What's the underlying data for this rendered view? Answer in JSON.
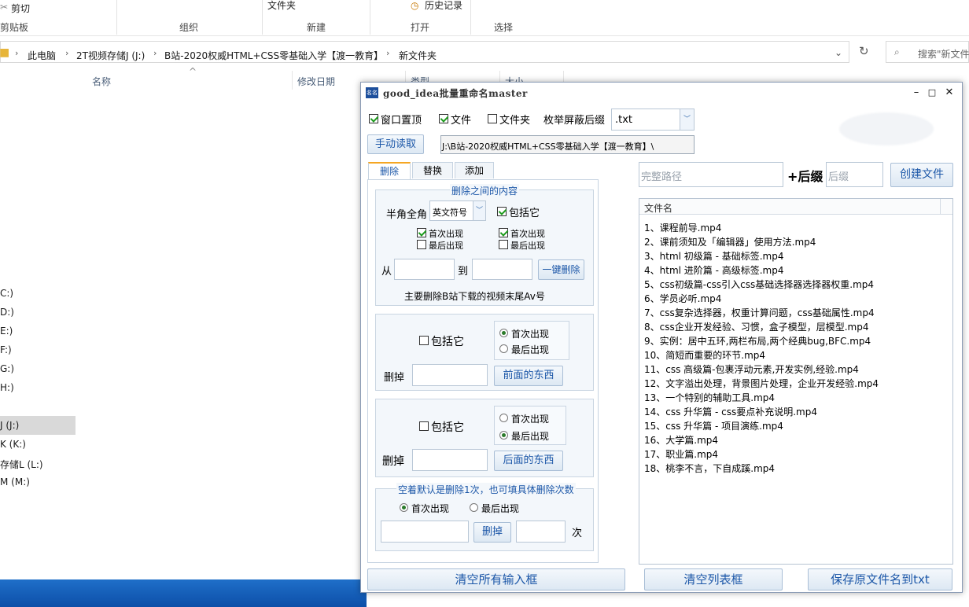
{
  "explorer": {
    "ribbon": {
      "cut_label": "剪切",
      "folder_label": "文件夹",
      "history_label": "历史记录",
      "groups": [
        "剪贴板",
        "组织",
        "新建",
        "打开",
        "选择"
      ]
    },
    "breadcrumb": [
      "此电脑",
      "2T视频存储J (J:)",
      "B站-2020权威HTML+CSS零基础入学【渡一教育】",
      "新文件夹"
    ],
    "search_placeholder": "搜索\"新文件",
    "columns": [
      "名称",
      "修改日期",
      "类型",
      "大小"
    ],
    "drives": [
      "C:)",
      "D:)",
      "E:)",
      "F:)",
      "G:)",
      "H:)",
      "J (J:)",
      "K (K:)",
      "存储L (L:)",
      "M (M:)"
    ]
  },
  "app": {
    "title": "good_idea批量重命名master",
    "logo_text": "名名",
    "window_buttons": {
      "minimize": "–",
      "maximize": "□",
      "close": "✕"
    },
    "options": {
      "topmost": {
        "label": "窗口置顶",
        "checked": true
      },
      "files": {
        "label": "文件",
        "checked": true
      },
      "folders": {
        "label": "文件夹",
        "checked": false
      },
      "mask_label": "枚举屏蔽后缀",
      "mask_value": ".txt"
    },
    "manual_read_label": "手动读取",
    "current_path": "J:\\B站-2020权威HTML+CSS零基础入学【渡一教育】\\",
    "tabs": [
      "删除",
      "替换",
      "添加"
    ],
    "active_tab": "删除",
    "between": {
      "title": "删除之间的内容",
      "width_label": "半角全角",
      "width_value": "英文符号",
      "include_label": "包括它",
      "left_first": "首次出现",
      "left_last": "最后出现",
      "right_first": "首次出现",
      "right_last": "最后出现",
      "from_label": "从",
      "to_label": "到",
      "action_label": "一键删除",
      "hint": "主要删除B站下载的视频末尾Av号"
    },
    "before": {
      "include_label": "包括它",
      "first_label": "首次出现",
      "last_label": "最后出现",
      "delete_label": "删掉",
      "action_label": "前面的东西"
    },
    "after": {
      "include_label": "包括它",
      "first_label": "首次出现",
      "last_label": "最后出现",
      "delete_label": "删掉",
      "action_label": "后面的东西"
    },
    "count_group": {
      "title": "空着默认是删除1次，也可填具体删除次数",
      "first_label": "首次出现",
      "last_label": "最后出现",
      "action_label": "删掉",
      "times_label": "次"
    },
    "create": {
      "full_path_placeholder": "完整路径",
      "suffix_label": "+后缀",
      "suffix_placeholder": "后缀",
      "action_label": "创建文件"
    },
    "file_list": {
      "header": "文件名",
      "items": [
        "1、课程前导.mp4",
        "2、课前须知及「编辑器」使用方法.mp4",
        "3、html 初级篇 - 基础标签.mp4",
        "4、html 进阶篇 - 高级标签.mp4",
        "5、css初级篇-css引入css基础选择器选择器权重.mp4",
        "6、学员必听.mp4",
        "7、css复杂选择器，权重计算问题，css基础属性.mp4",
        "8、css企业开发经验、习惯，盒子模型，层模型.mp4",
        "9、实例：居中五环,两栏布局,两个经典bug,BFC.mp4",
        "10、简短而重要的环节.mp4",
        "11、css 高级篇-包裹浮动元素,开发实例,经验.mp4",
        "12、文字溢出处理，背景图片处理，企业开发经验.mp4",
        "13、一个特别的辅助工具.mp4",
        "14、css 升华篇 - css要点补充说明.mp4",
        "15、css 升华篇 - 项目演练.mp4",
        "16、大学篇.mp4",
        "17、职业篇.mp4",
        "18、桃李不言，下自成蹊.mp4"
      ]
    },
    "bottom": {
      "clear_inputs": "清空所有输入框",
      "clear_list": "清空列表框",
      "save_names": "保存原文件名到txt"
    }
  }
}
